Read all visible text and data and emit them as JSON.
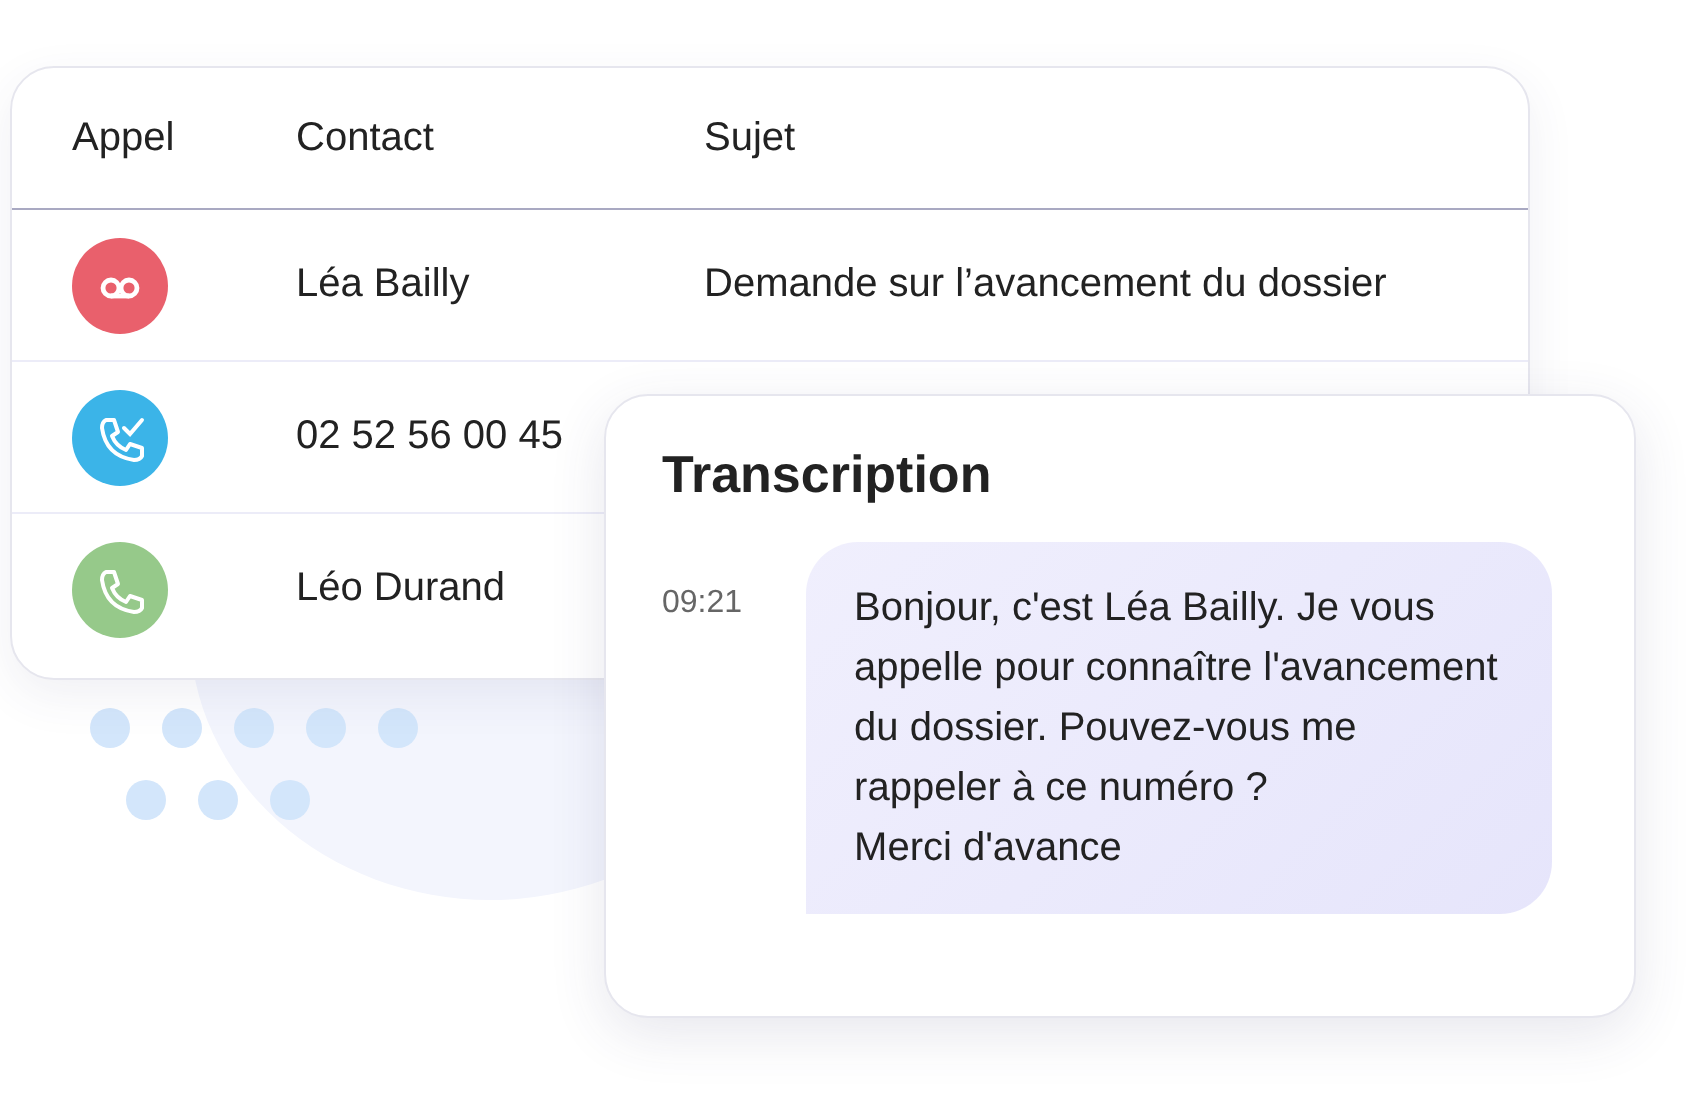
{
  "calls_table": {
    "columns": [
      "Appel",
      "Contact",
      "Sujet"
    ],
    "rows": [
      {
        "kind": "voicemail",
        "color": "#e9606c",
        "contact": "Léa Bailly",
        "subject": "Demande sur l’avancement du dossier"
      },
      {
        "kind": "answered",
        "color": "#3bb4e8",
        "contact": "02 52 56 00 45"
      },
      {
        "kind": "call",
        "color": "#96c98a",
        "contact": "Léo Durand"
      }
    ]
  },
  "transcription": {
    "title": "Transcription",
    "time": "09:21",
    "message": "Bonjour, c'est Léa Bailly. Je vous appelle pour connaître l'avancement du dossier. Pouvez-vous me rappeler à ce numéro ?\nMerci d'avance"
  }
}
